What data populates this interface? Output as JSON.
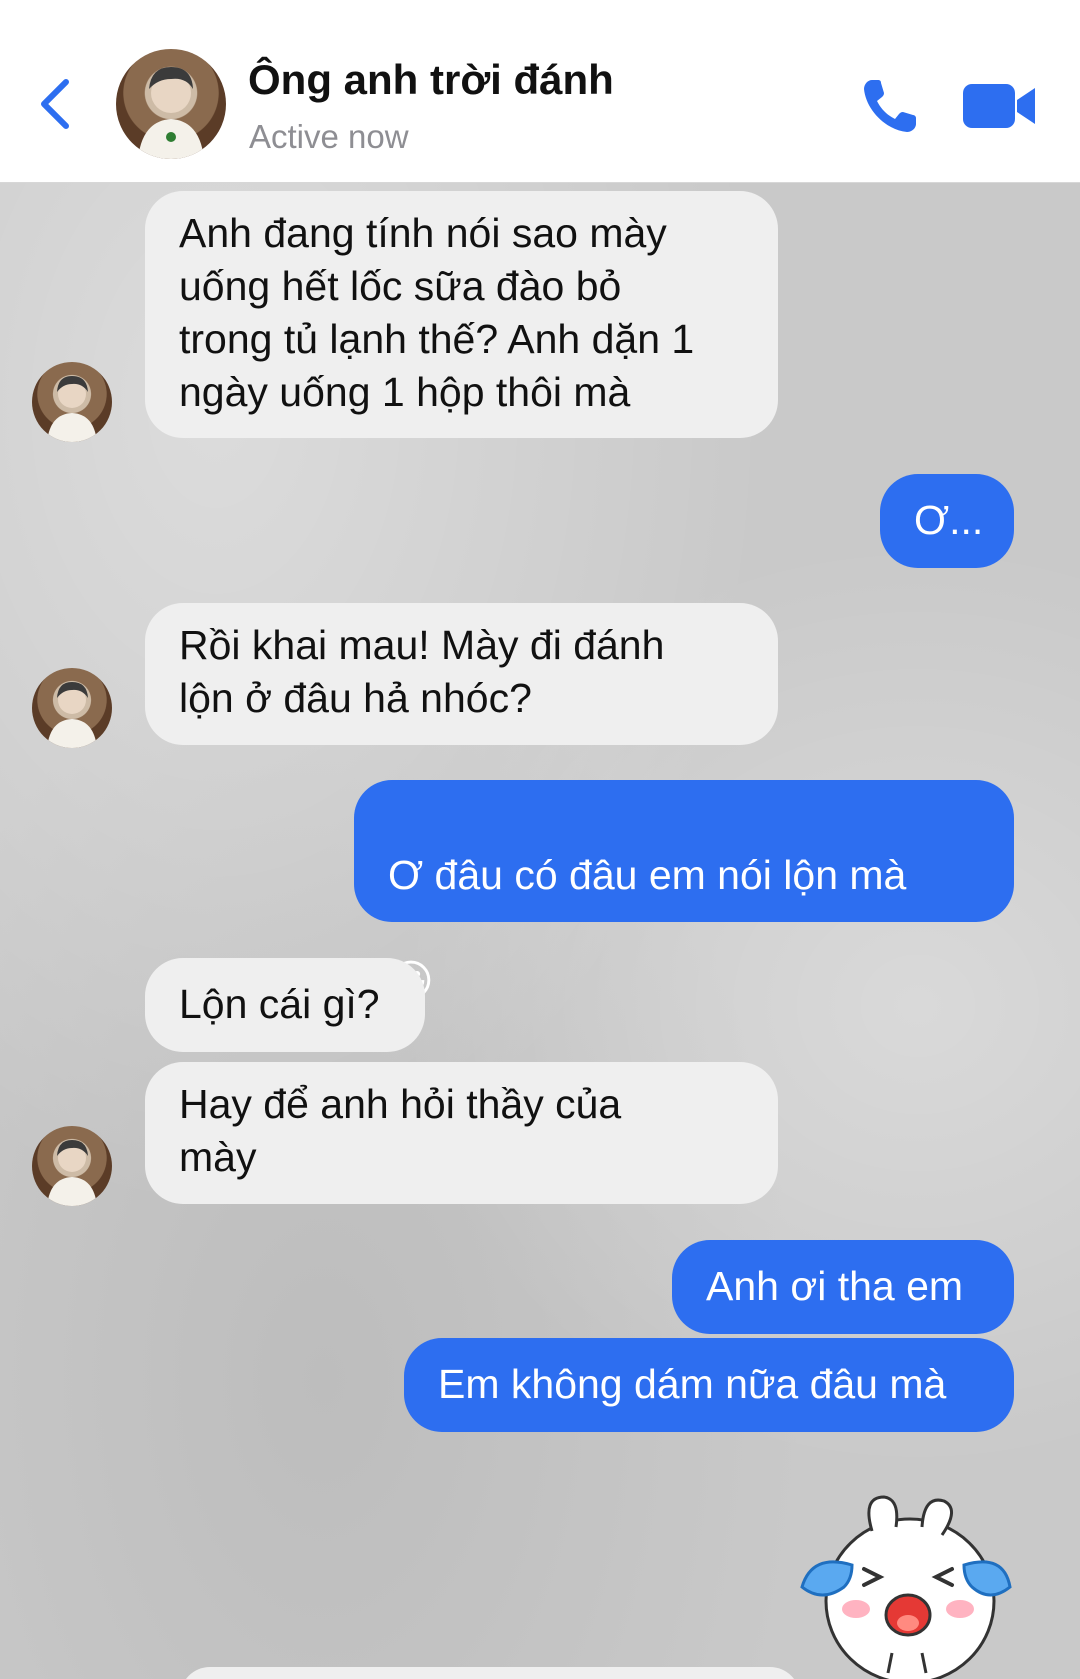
{
  "header": {
    "title": "Ông anh trời đánh",
    "status": "Active now",
    "icons": {
      "back": "chevron-left-icon",
      "call": "phone-icon",
      "video": "video-camera-icon"
    },
    "accent_color": "#2d6ef0"
  },
  "messages": [
    {
      "sender": "contact",
      "text": "Anh đang tính nói sao mày\nuống hết lốc sữa đào bỏ\ntrong tủ lạnh thế? Anh dặn 1\nngày uống 1 hộp thôi mà"
    },
    {
      "sender": "me",
      "text": "Ơ..."
    },
    {
      "sender": "contact",
      "text": "Rồi khai mau! Mày đi đánh\nlộn ở đâu hả nhóc?"
    },
    {
      "sender": "me",
      "text": "Ơ đâu có đâu em nói lộn mà",
      "emoji": "😀"
    },
    {
      "sender": "contact",
      "text": "Lộn cái gì?"
    },
    {
      "sender": "contact",
      "text": "Hay để anh hỏi thầy của\nmày"
    },
    {
      "sender": "me",
      "text": "Anh ơi tha em"
    },
    {
      "sender": "me",
      "text": "Em không dám nữa đâu mà"
    },
    {
      "sender": "me",
      "sticker": "crying-bunny-sticker"
    }
  ],
  "colors": {
    "incoming_bubble": "#efefef",
    "outgoing_bubble": "#2d6ef0",
    "chat_background": "#c9c9c9"
  }
}
